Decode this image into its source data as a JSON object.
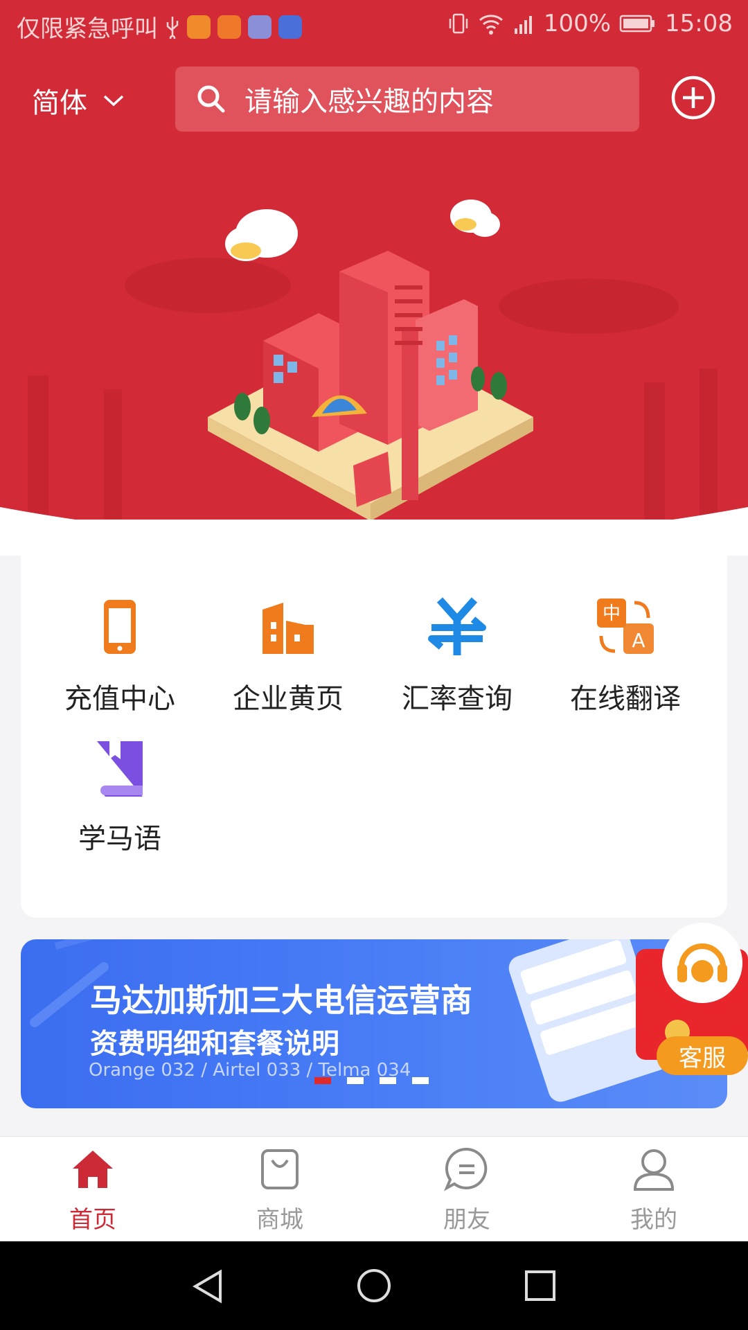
{
  "status_bar": {
    "carrier_text": "仅限紧急呼叫",
    "battery": "100%",
    "time": "15:08"
  },
  "header": {
    "language": "简体",
    "search_placeholder": "请输入感兴趣的内容"
  },
  "services": [
    {
      "label": "充值中心",
      "icon": "phone-icon",
      "color": "#f07b1d"
    },
    {
      "label": "企业黄页",
      "icon": "building-icon",
      "color": "#f07b1d"
    },
    {
      "label": "汇率查询",
      "icon": "yen-exchange-icon",
      "color": "#1e8ae6"
    },
    {
      "label": "在线翻译",
      "icon": "translate-icon",
      "color": "#f07b1d"
    },
    {
      "label": "学马语",
      "icon": "book-icon",
      "color": "#7b4fe0"
    }
  ],
  "banner": {
    "title": "马达加斯加三大电信运营商",
    "subtitle": "资费明细和套餐说明",
    "caption": "Orange 032 / Airtel 033 / Telma 034",
    "slide_count": 4,
    "active_slide": 1
  },
  "customer_service": {
    "label": "客服"
  },
  "tabs": [
    {
      "label": "首页",
      "icon": "home-icon",
      "active": true
    },
    {
      "label": "商城",
      "icon": "shopping-bag-icon",
      "active": false
    },
    {
      "label": "朋友",
      "icon": "chat-icon",
      "active": false
    },
    {
      "label": "我的",
      "icon": "user-icon",
      "active": false
    }
  ],
  "colors": {
    "brand_red": "#d22b37",
    "banner_blue": "#4a7ef6",
    "accent_orange": "#f39a1f"
  }
}
